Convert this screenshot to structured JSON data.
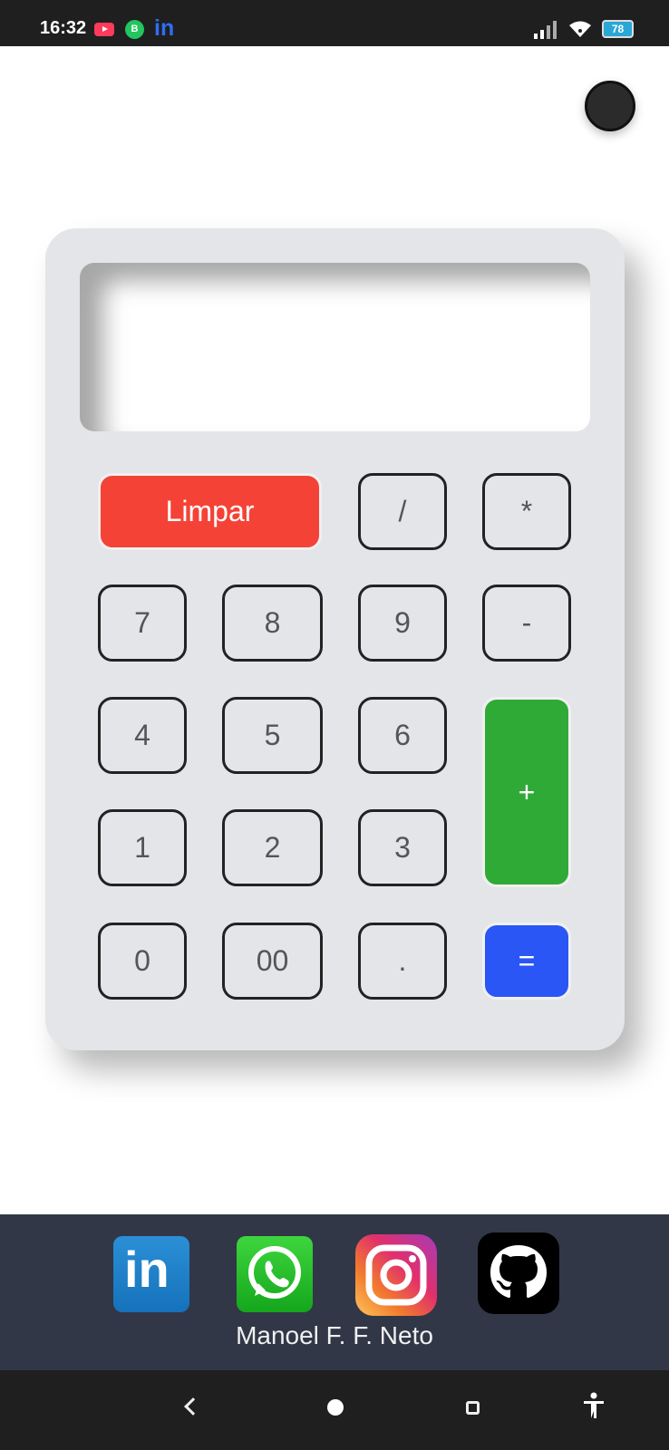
{
  "status_bar": {
    "time": "16:32",
    "notification_b": "B",
    "notification_in": "in",
    "battery": "78"
  },
  "calculator": {
    "display_value": "",
    "keys": {
      "clear": "Limpar",
      "divide": "/",
      "multiply": "*",
      "seven": "7",
      "eight": "8",
      "nine": "9",
      "minus": "-",
      "four": "4",
      "five": "5",
      "six": "6",
      "plus": "+",
      "one": "1",
      "two": "2",
      "three": "3",
      "zero": "0",
      "double_zero": "00",
      "decimal": ".",
      "equals": "="
    }
  },
  "footer": {
    "linkedin_text": "in",
    "author_name": "Manoel F. F. Neto"
  },
  "colors": {
    "clear_key": "#f44336",
    "plus_key": "#2faa36",
    "equals_key": "#2a56f6",
    "footer_bg": "#313747"
  }
}
